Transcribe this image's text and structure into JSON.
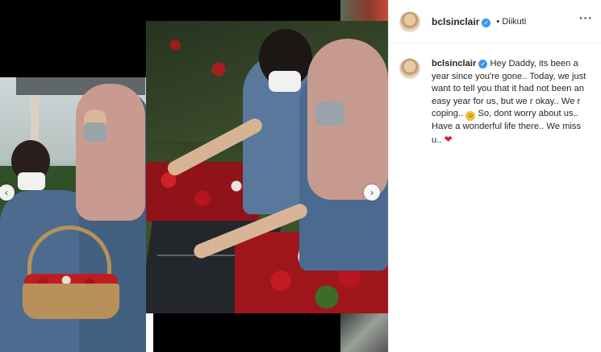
{
  "post": {
    "username": "bclsinclair",
    "follow_status": "Diikuti",
    "more_icon": "more-options-icon",
    "verified_icon": "verified-badge-icon"
  },
  "caption": {
    "username": "bclsinclair",
    "text_part1": "Hey Daddy, its been a year since you're gone.. Today, we just want to tell you that it had not been an easy year for us, but we r okay.. We r coping..",
    "text_part2": "So, dont worry about us.. Have a wonderful life there.. We miss u..",
    "emoji1": "slightly-smiling-face",
    "emoji2": "red-heart"
  },
  "carousel": {
    "prev_icon": "chevron-left-icon",
    "next_icon": "chevron-right-icon"
  },
  "colors": {
    "verified": "#3897f0",
    "heart": "#d8232f",
    "text": "#262626",
    "border": "#efefef"
  }
}
